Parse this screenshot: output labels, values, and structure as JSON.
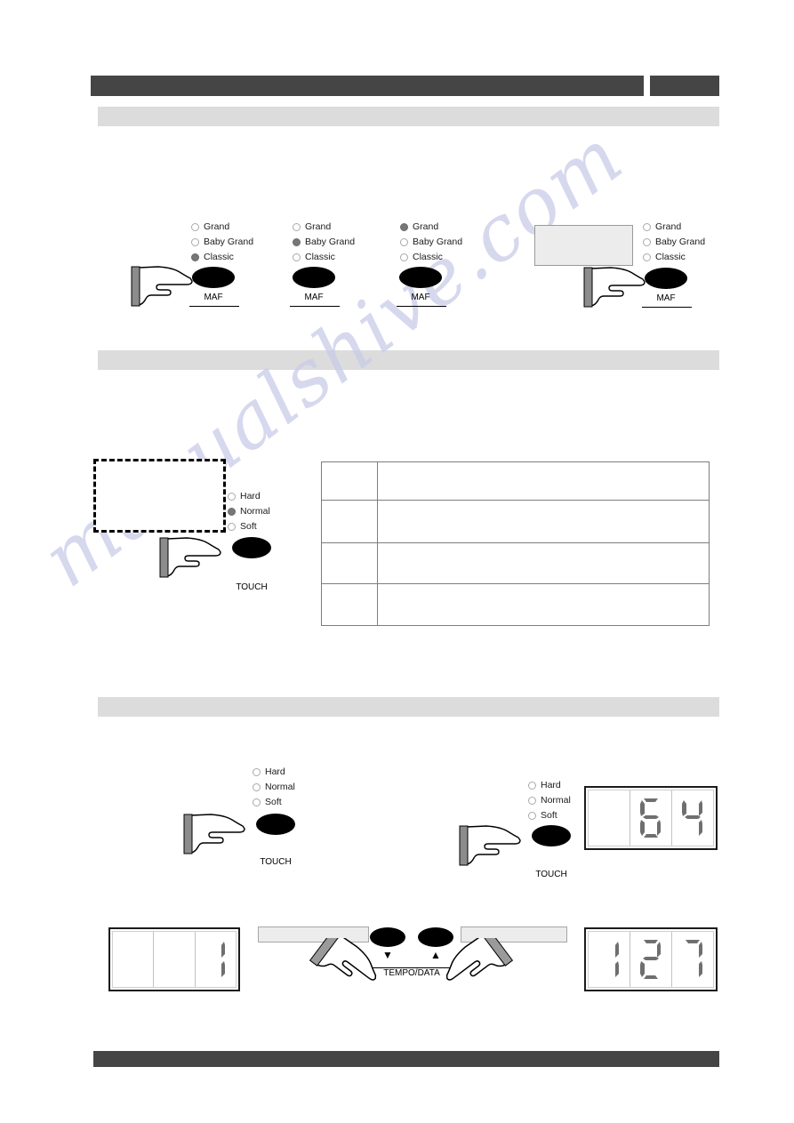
{
  "page": {
    "watermark_text": "manualshive.com",
    "background_color": "#ffffff",
    "header_bar_color": "#454545",
    "section_bar_color": "#dcdcdc"
  },
  "header": {
    "title": "",
    "right_tab_label": ""
  },
  "sections": [
    {
      "id": "section-1",
      "heading": ""
    },
    {
      "id": "section-2",
      "heading": ""
    },
    {
      "id": "section-3",
      "heading": ""
    }
  ],
  "section1": {
    "steps": [
      {
        "name": "step-1",
        "options": [
          {
            "label": "Grand",
            "selected": false
          },
          {
            "label": "Baby Grand",
            "selected": false
          },
          {
            "label": "Classic",
            "selected": true
          }
        ],
        "button_label": "MAF",
        "has_hand": true,
        "has_display": false
      },
      {
        "name": "step-2",
        "options": [
          {
            "label": "Grand",
            "selected": false
          },
          {
            "label": "Baby Grand",
            "selected": true
          },
          {
            "label": "Classic",
            "selected": false
          }
        ],
        "button_label": "MAF",
        "has_hand": false,
        "has_display": false
      },
      {
        "name": "step-3",
        "options": [
          {
            "label": "Grand",
            "selected": true
          },
          {
            "label": "Baby Grand",
            "selected": false
          },
          {
            "label": "Classic",
            "selected": false
          }
        ],
        "button_label": "MAF",
        "has_hand": false,
        "has_display": false
      },
      {
        "name": "step-4",
        "options": [
          {
            "label": "Grand",
            "selected": false
          },
          {
            "label": "Baby Grand",
            "selected": false
          },
          {
            "label": "Classic",
            "selected": false
          }
        ],
        "button_label": "MAF",
        "has_hand": true,
        "has_display": true,
        "display_value": ""
      }
    ]
  },
  "section2": {
    "panel": {
      "display_value": "",
      "options": [
        {
          "label": "Hard",
          "selected": false
        },
        {
          "label": "Normal",
          "selected": true
        },
        {
          "label": "Soft",
          "selected": false
        }
      ],
      "button_label": "TOUCH"
    },
    "table": {
      "rows": [
        {
          "setting": "",
          "description": ""
        },
        {
          "setting": "",
          "description": ""
        },
        {
          "setting": "",
          "description": ""
        },
        {
          "setting": "",
          "description": ""
        }
      ]
    }
  },
  "section3": {
    "step_left": {
      "options": [
        {
          "label": "Hard",
          "selected": false
        },
        {
          "label": "Normal",
          "selected": false
        },
        {
          "label": "Soft",
          "selected": false
        }
      ],
      "button_label": "TOUCH"
    },
    "step_right": {
      "options": [
        {
          "label": "Hard",
          "selected": false
        },
        {
          "label": "Normal",
          "selected": false
        },
        {
          "label": "Soft",
          "selected": false
        }
      ],
      "button_label": "TOUCH",
      "display_value": "64",
      "display_digits": [
        "",
        "6",
        "4"
      ]
    },
    "bottom": {
      "left_display_value": "1",
      "left_display_digits": [
        "",
        "",
        "1"
      ],
      "right_display_value": "127",
      "right_display_digits": [
        "1",
        "2",
        "7"
      ],
      "tempo_label": "TEMPO/DATA",
      "down_arrow": "▼",
      "up_arrow": "▲"
    }
  }
}
